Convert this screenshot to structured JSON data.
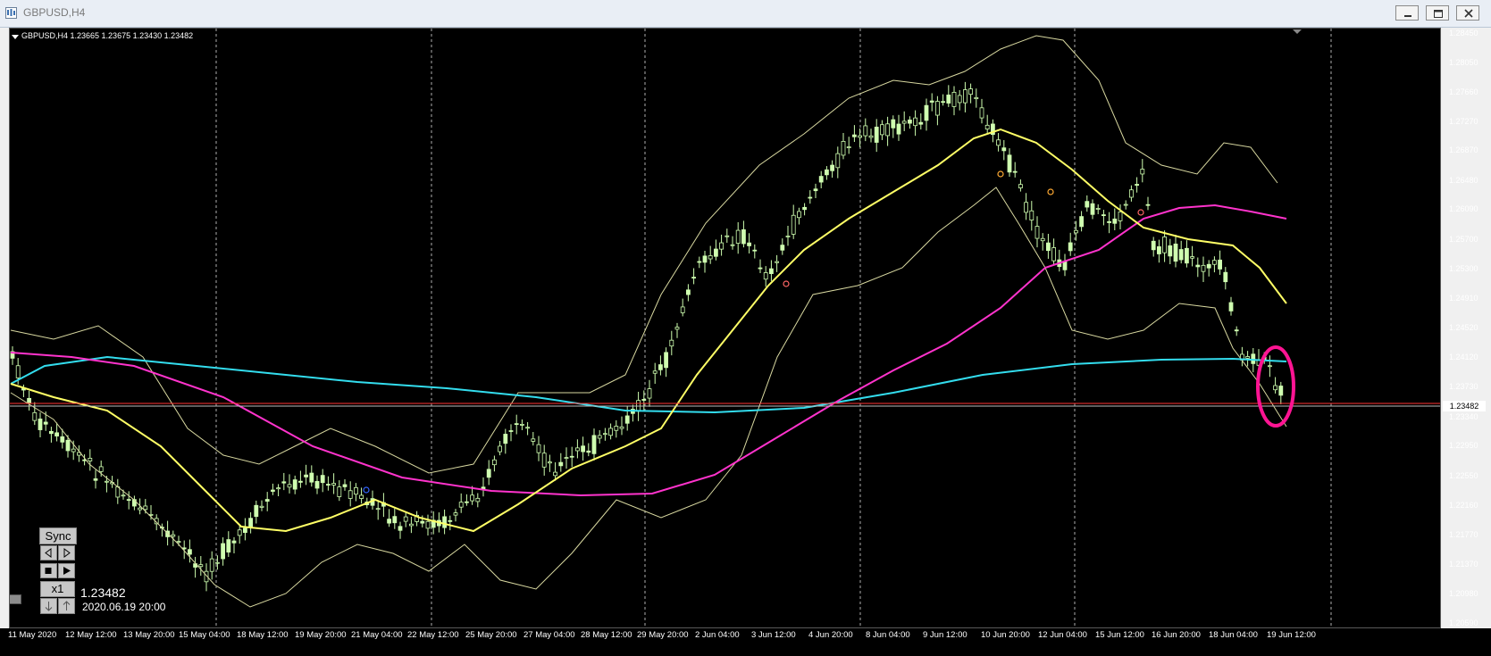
{
  "window": {
    "title": "GBPUSD,H4",
    "buttons": [
      "minimize-icon",
      "restore-icon",
      "close-icon"
    ]
  },
  "chart": {
    "symbol_info": "GBPUSD,H4  1.23665 1.23675 1.23430 1.23482",
    "current_price_tag": "1.23482",
    "price_labels": [
      "1.28450",
      "1.28050",
      "1.27660",
      "1.27270",
      "1.26870",
      "1.26480",
      "1.26090",
      "1.25700",
      "1.25300",
      "1.24910",
      "1.24520",
      "1.24120",
      "1.23730",
      "1.23340",
      "1.22950",
      "1.22550",
      "1.22160",
      "1.21770",
      "1.21370",
      "1.20980",
      "1.20590"
    ],
    "time_labels": [
      "11 May 2020",
      "12 May 12:00",
      "13 May 20:00",
      "15 May 04:00",
      "18 May 12:00",
      "19 May 20:00",
      "21 May 04:00",
      "22 May 12:00",
      "25 May 20:00",
      "27 May 04:00",
      "28 May 12:00",
      "29 May 20:00",
      "2 Jun 04:00",
      "3 Jun 12:00",
      "4 Jun 20:00",
      "8 Jun 04:00",
      "9 Jun 12:00",
      "10 Jun 20:00",
      "12 Jun 04:00",
      "15 Jun 12:00",
      "16 Jun 20:00",
      "18 Jun 04:00",
      "19 Jun 12:00"
    ],
    "colors": {
      "background": "#000000",
      "candle": "#cfffb0",
      "ma_fast": "#ffff66",
      "ma_slow": "#ff33cc",
      "ma_long": "#33ddee",
      "bollinger": "#d8d8a0",
      "current_price_line": "#ff3333",
      "highlight_circle": "#ff1493"
    }
  },
  "playback": {
    "sync_label": "Sync",
    "speed_label": "x1",
    "cursor_price": "1.23482",
    "cursor_time": "2020.06.19 20:00",
    "controls": [
      "step-back-icon",
      "step-forward-icon",
      "stop-icon",
      "play-icon",
      "arrow-down-icon",
      "arrow-up-icon"
    ]
  }
}
